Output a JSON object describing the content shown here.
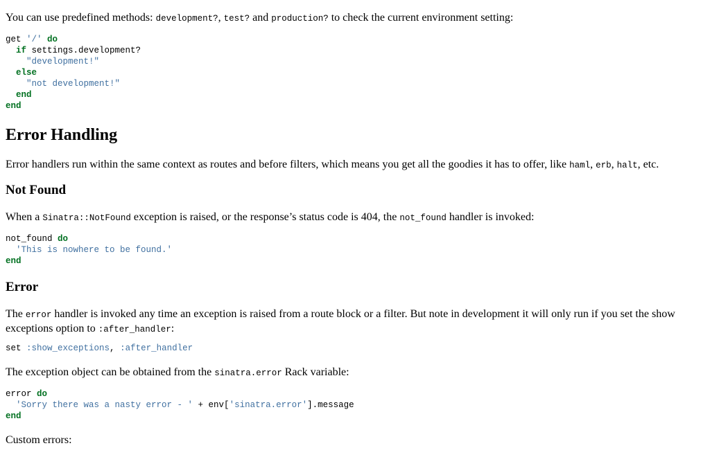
{
  "intro": {
    "pre": "You can use predefined methods: ",
    "code1": "development?",
    "sep1": ", ",
    "code2": "test?",
    "sep2": " and ",
    "code3": "production?",
    "post": " to check the current environment setting:"
  },
  "code_env": {
    "l1_a": "get ",
    "l1_str": "'/'",
    "l1_kw": " do",
    "l2_kw": "  if",
    "l2_rest": " settings.development?",
    "l3_str": "    \"development!\"",
    "l4_kw": "  else",
    "l5_str": "    \"not development!\"",
    "l6_kw": "  end",
    "l7_kw": "end"
  },
  "error_handling": {
    "heading": "Error Handling",
    "para_pre": "Error handlers run within the same context as routes and before filters, which means you get all the goodies it has to offer, like ",
    "c1": "haml",
    "s1": ", ",
    "c2": "erb",
    "s2": ", ",
    "c3": "halt",
    "para_post": ", etc."
  },
  "not_found": {
    "heading": "Not Found",
    "p_pre": "When a ",
    "p_code1": "Sinatra::NotFound",
    "p_mid": " exception is raised, or the response’s status code is 404, the ",
    "p_code2": "not_found",
    "p_post": " handler is invoked:",
    "code_l1": "not_found",
    "code_l1_kw": " do",
    "code_l2": "  'This is nowhere to be found.'",
    "code_l3": "end"
  },
  "error": {
    "heading": "Error",
    "p1_pre": "The ",
    "p1_code": "error",
    "p1_mid": " handler is invoked any time an exception is raised from a route block or a filter. But note in development it will only run if you set the show exceptions option to ",
    "p1_code2": ":after_handler",
    "p1_post": ":",
    "set_code_a": "set ",
    "set_code_sym1": ":show_exceptions",
    "set_code_comma": ", ",
    "set_code_sym2": ":after_handler",
    "p2_pre": "The exception object can be obtained from the ",
    "p2_code": "sinatra.error",
    "p2_post": " Rack variable:",
    "code_l1": "error",
    "code_l1_kw": " do",
    "code_l2_str1": "  'Sorry there was a nasty error - '",
    "code_l2_mid": " + env[",
    "code_l2_str2": "'sinatra.error'",
    "code_l2_post": "].message",
    "code_l3": "end",
    "custom": "Custom errors:"
  }
}
